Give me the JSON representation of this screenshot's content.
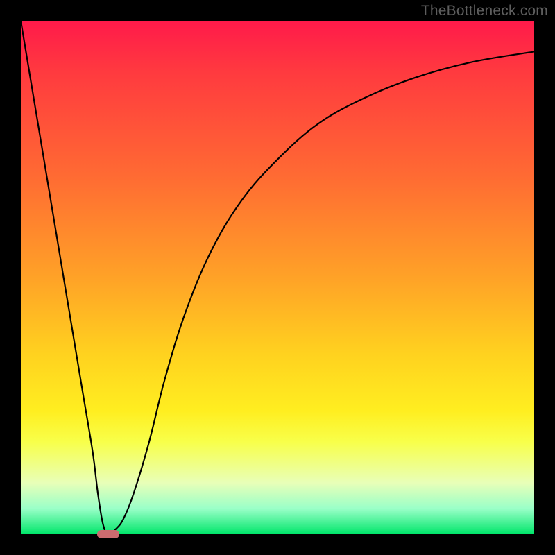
{
  "watermark": "TheBottleneck.com",
  "chart_data": {
    "type": "line",
    "title": "",
    "xlabel": "",
    "ylabel": "",
    "xlim": [
      0,
      100
    ],
    "ylim": [
      0,
      100
    ],
    "legend": false,
    "grid": false,
    "axes_visible": false,
    "background": "red-to-green vertical gradient",
    "gradient_stops": [
      {
        "pos": 0,
        "color": "#ff1a4a"
      },
      {
        "pos": 30,
        "color": "#ff6a33"
      },
      {
        "pos": 65,
        "color": "#ffd21f"
      },
      {
        "pos": 82,
        "color": "#f8ff4a"
      },
      {
        "pos": 100,
        "color": "#00e66a"
      }
    ],
    "series": [
      {
        "name": "bottleneck-curve",
        "color": "#000000",
        "x": [
          0,
          2,
          4,
          6,
          8,
          10,
          12,
          14,
          15,
          16,
          17,
          18.5,
          20,
          22,
          25,
          28,
          32,
          37,
          43,
          50,
          58,
          67,
          77,
          88,
          100
        ],
        "y": [
          100,
          88,
          76,
          64,
          52,
          40,
          28,
          16,
          8,
          2,
          0,
          1,
          3,
          8,
          18,
          30,
          43,
          55,
          65,
          73,
          80,
          85,
          89,
          92,
          94
        ]
      }
    ],
    "annotations": [
      {
        "name": "ideal-zone-marker",
        "type": "pill",
        "x": 17,
        "y": 0,
        "width_pct": 4.3,
        "height_pct": 1.6,
        "color": "#cc6b6f"
      }
    ]
  }
}
